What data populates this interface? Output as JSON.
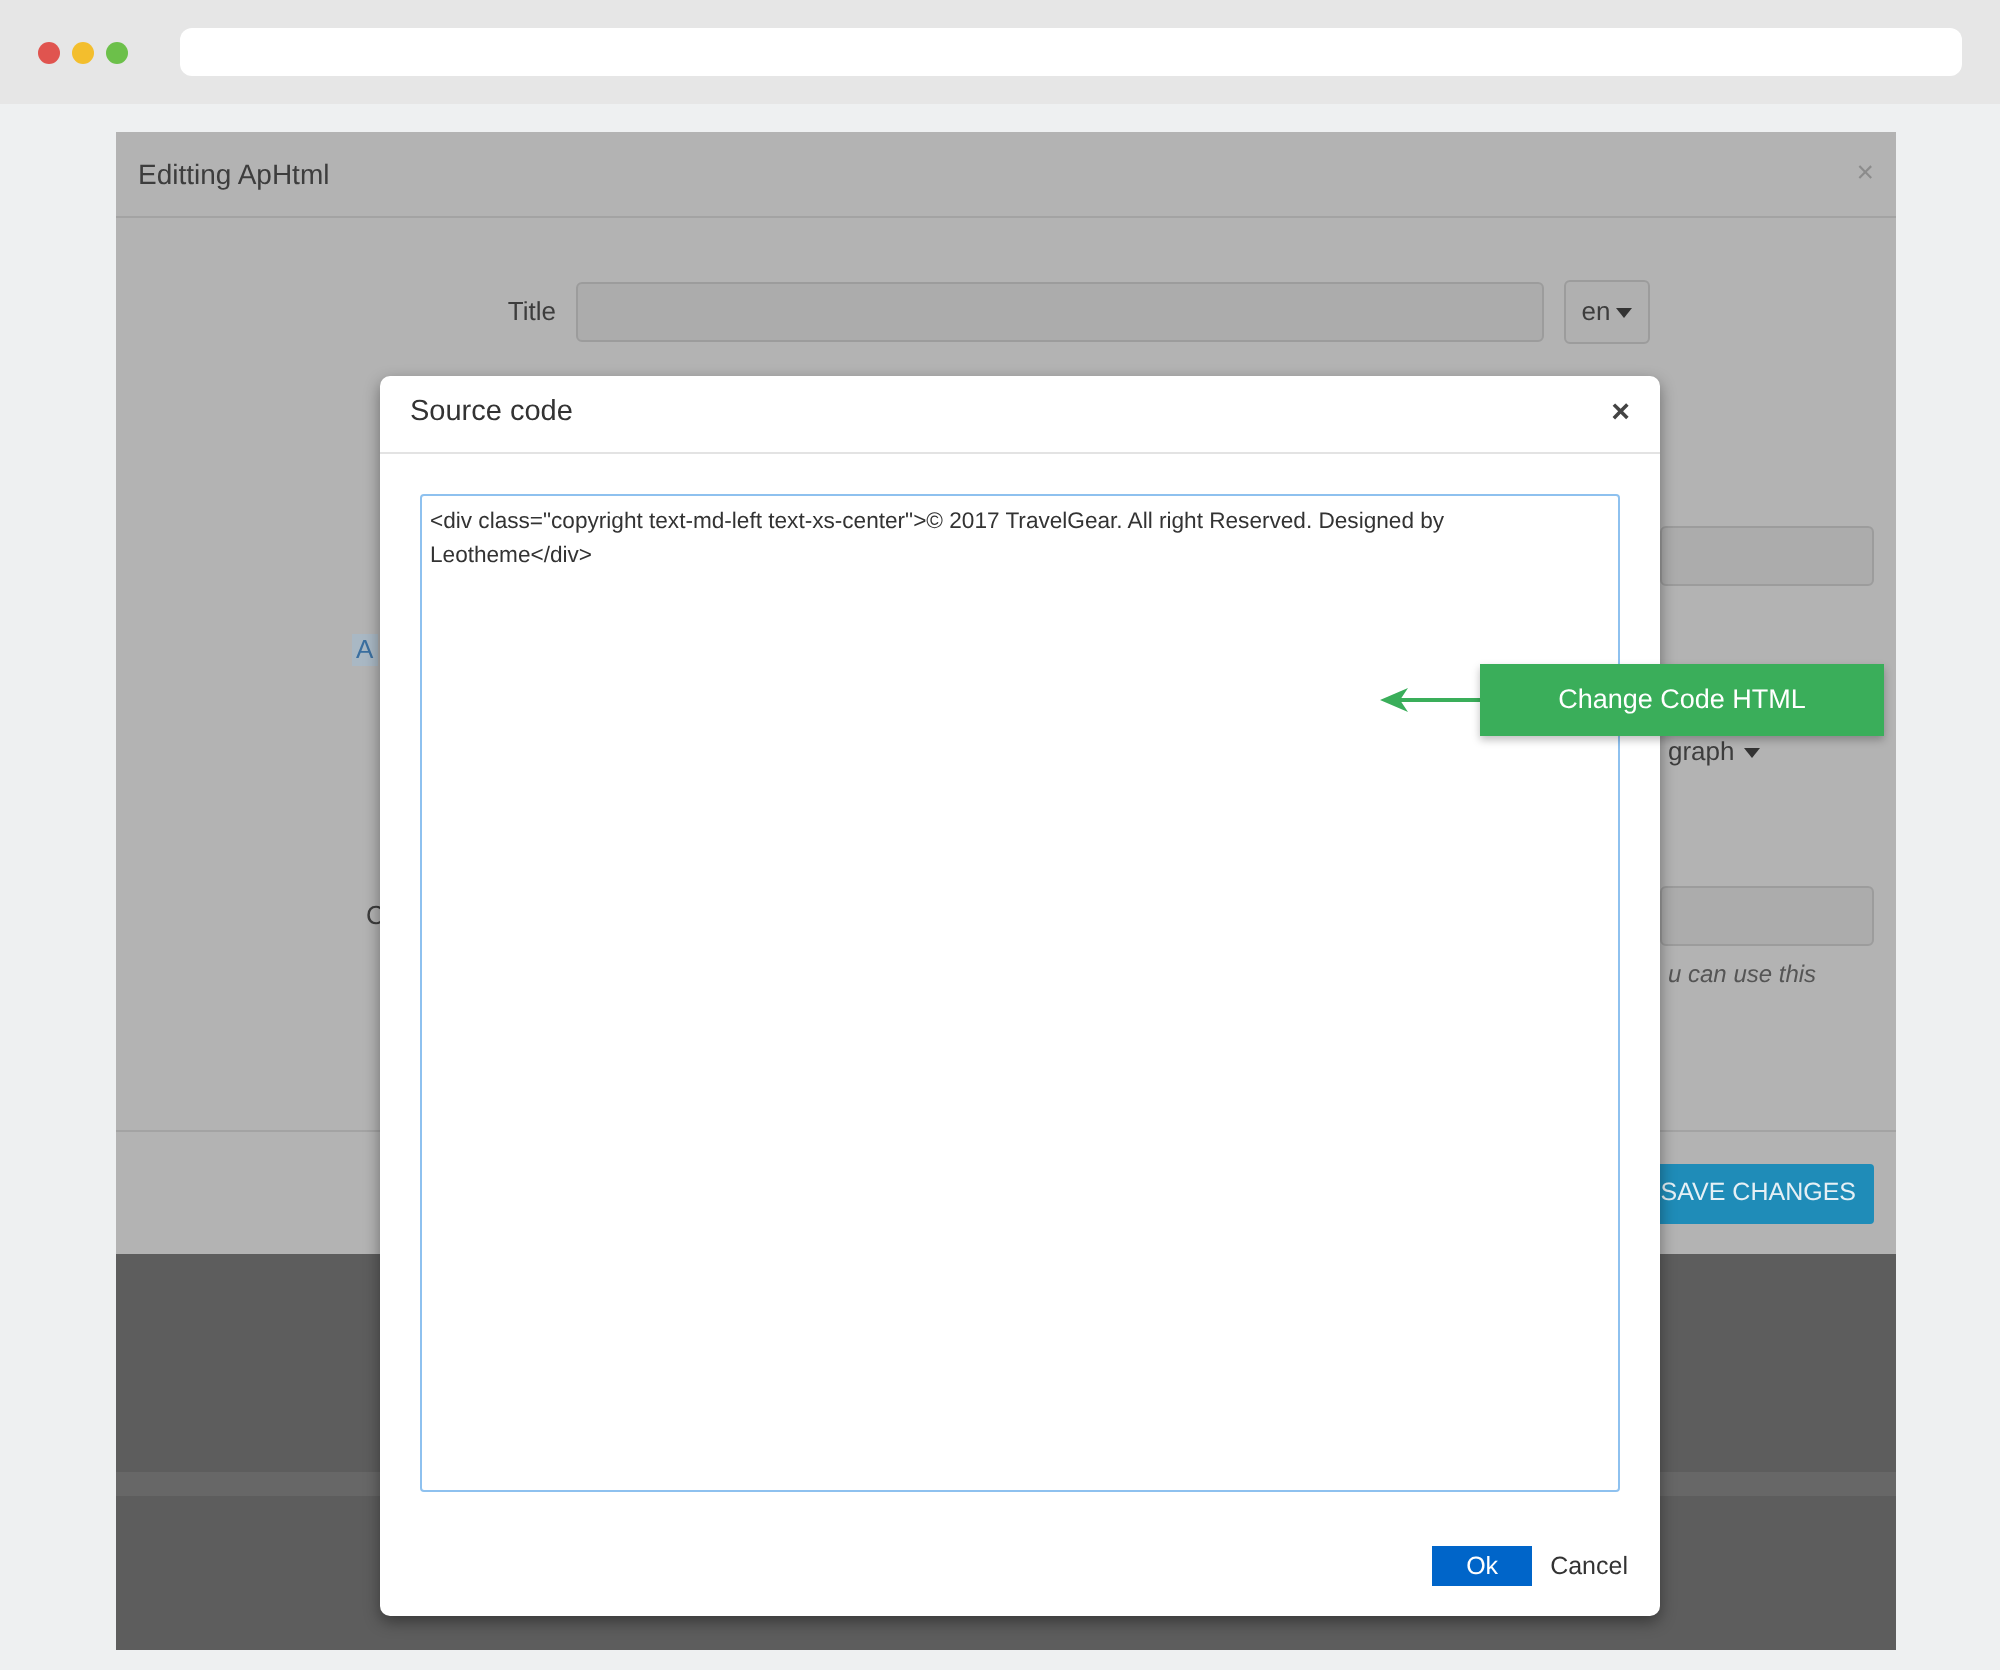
{
  "background_dialog": {
    "title": "Editting ApHtml",
    "close": "×",
    "title_label": "Title",
    "language": "en",
    "cut_label_a": "A",
    "format_dropdown": "graph",
    "cut_label_c": "C",
    "hint": "u can use this",
    "save_button": "SAVE CHANGES"
  },
  "source_dialog": {
    "title": "Source code",
    "close": "×",
    "code": "<div class=\"copyright text-md-left text-xs-center\">© 2017 TravelGear. All right Reserved. Designed by Leotheme</div>",
    "ok_button": "Ok",
    "cancel_button": "Cancel"
  },
  "callout": {
    "label": "Change Code HTML"
  }
}
